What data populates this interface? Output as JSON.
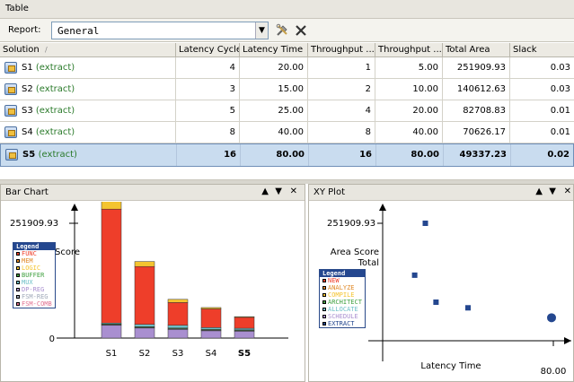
{
  "table_panel": {
    "title": "Table",
    "report_label": "Report:",
    "report_value": "General"
  },
  "columns": [
    "Solution",
    "Latency Cycles",
    "Latency Time",
    "Throughput ...",
    "Throughput ...",
    "Total Area",
    "Slack"
  ],
  "rows": [
    {
      "id": "S1",
      "tag": "(extract)",
      "latency_cycles": "4",
      "latency_time": "20.00",
      "throughput_cycles": "1",
      "throughput_time": "5.00",
      "total_area": "251909.93",
      "slack": "0.03"
    },
    {
      "id": "S2",
      "tag": "(extract)",
      "latency_cycles": "3",
      "latency_time": "15.00",
      "throughput_cycles": "2",
      "throughput_time": "10.00",
      "total_area": "140612.63",
      "slack": "0.03"
    },
    {
      "id": "S3",
      "tag": "(extract)",
      "latency_cycles": "5",
      "latency_time": "25.00",
      "throughput_cycles": "4",
      "throughput_time": "20.00",
      "total_area": "82708.83",
      "slack": "0.01"
    },
    {
      "id": "S4",
      "tag": "(extract)",
      "latency_cycles": "8",
      "latency_time": "40.00",
      "throughput_cycles": "8",
      "throughput_time": "40.00",
      "total_area": "70626.17",
      "slack": "0.01"
    },
    {
      "id": "S5",
      "tag": "(extract)",
      "latency_cycles": "16",
      "latency_time": "80.00",
      "throughput_cycles": "16",
      "throughput_time": "80.00",
      "total_area": "49337.23",
      "slack": "0.02",
      "selected": true
    }
  ],
  "bar_panel": {
    "title": "Bar Chart"
  },
  "xy_panel": {
    "title": "XY Plot"
  },
  "chart_data": [
    {
      "type": "bar",
      "stacked": true,
      "categories": [
        "S1",
        "S2",
        "S3",
        "S4",
        "S5"
      ],
      "highlighted_category": "S5",
      "y_tick_labels": [
        "251909.93",
        "0"
      ],
      "ylabel": "Score",
      "ylim": [
        0,
        251909.93
      ],
      "legend_title": "Legend",
      "legend_placement": "left",
      "series": [
        {
          "name": "DP-REG",
          "color": "#a98fd0",
          "values": [
            28000,
            22000,
            19000,
            16000,
            15000
          ]
        },
        {
          "name": "FSM-REG",
          "color": "#9fa8b8",
          "values": [
            1500,
            1500,
            1500,
            1500,
            1500
          ]
        },
        {
          "name": "BUFFER",
          "color": "#3fa03f",
          "values": [
            1500,
            1500,
            1500,
            1500,
            1500
          ]
        },
        {
          "name": "MUX",
          "color": "#6fc0c8",
          "values": [
            2000,
            5000,
            6000,
            4000,
            3500
          ]
        },
        {
          "name": "FUNC",
          "color": "#ee3e2a",
          "values": [
            250000,
            127000,
            50000,
            41000,
            24000
          ]
        },
        {
          "name": "LOGIC",
          "color": "#f4c430",
          "values": [
            26000,
            11000,
            7000,
            3000,
            1500
          ]
        }
      ],
      "legend": [
        {
          "name": "FUNC",
          "color": "#ee3e2a"
        },
        {
          "name": "MEM",
          "color": "#e08a2a"
        },
        {
          "name": "LOGIC",
          "color": "#f4c430"
        },
        {
          "name": "BUFFER",
          "color": "#3fa03f"
        },
        {
          "name": "MUX",
          "color": "#6fc0c8"
        },
        {
          "name": "DP-REG",
          "color": "#a98fd0"
        },
        {
          "name": "FSM-REG",
          "color": "#9fa8b8"
        },
        {
          "name": "FSM-COMB",
          "color": "#e07090"
        }
      ]
    },
    {
      "type": "scatter",
      "xlabel": "Latency Time",
      "ylabel": "Area Score Total",
      "x_tick_labels": [
        "80.00"
      ],
      "y_tick_labels": [
        "251909.93"
      ],
      "xlim": [
        0,
        80
      ],
      "ylim": [
        0,
        251909.93
      ],
      "points": [
        {
          "label": "S1",
          "x": 20.0,
          "y": 251909.93
        },
        {
          "label": "S2",
          "x": 15.0,
          "y": 140612.63
        },
        {
          "label": "S3",
          "x": 25.0,
          "y": 82708.83
        },
        {
          "label": "S4",
          "x": 40.0,
          "y": 70626.17
        },
        {
          "label": "S5",
          "x": 80.0,
          "y": 49337.23,
          "highlighted": true
        }
      ],
      "point_color": "#24478f",
      "legend_title": "Legend",
      "legend_placement": "left",
      "legend": [
        {
          "name": "NEW",
          "color": "#ee3e2a"
        },
        {
          "name": "ANALYZE",
          "color": "#e08a2a"
        },
        {
          "name": "COMPILE",
          "color": "#f4c430"
        },
        {
          "name": "ARCHITECT",
          "color": "#3fa03f"
        },
        {
          "name": "ALLOCATE",
          "color": "#6fc0c8"
        },
        {
          "name": "SCHEDULE",
          "color": "#a98fd0"
        },
        {
          "name": "EXTRACT",
          "color": "#24478f"
        }
      ]
    }
  ]
}
